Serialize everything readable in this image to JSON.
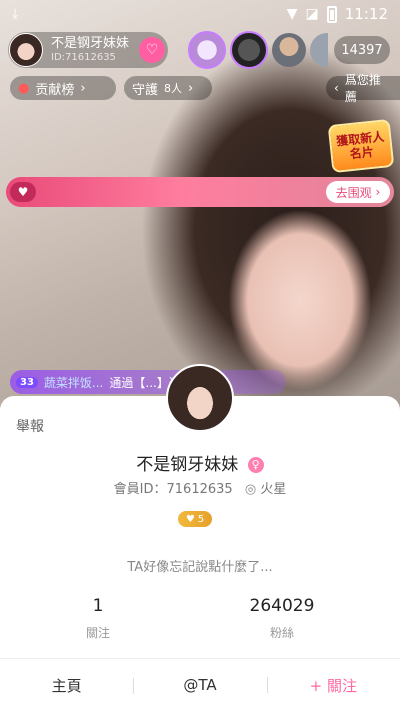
{
  "status_bar": {
    "time": "11:12",
    "download_icon": "download-icon",
    "wifi_icon": "wifi-icon",
    "signal_icon": "no-signal-icon"
  },
  "host": {
    "name": "不是钢牙妹妹",
    "id": "ID:71612635"
  },
  "viewers": {
    "count": "14397"
  },
  "chips": {
    "contribution": "贡献榜",
    "guard": "守護",
    "guard_count": "8人",
    "recommend": "爲您推薦"
  },
  "event_badge": {
    "text": "獲取新人名片"
  },
  "banner": {
    "button": "去围观"
  },
  "entry": {
    "level": "33",
    "user": "蔬菜拌饭...",
    "text": "通過【...】進入房間！"
  },
  "profile": {
    "report": "舉報",
    "name": "不是钢牙妹妹",
    "member_id": "會員ID：71612635",
    "location": "火星",
    "level": "5",
    "bio": "TA好像忘記說點什麼了...",
    "following_count": "1",
    "following_label": "關注",
    "fans_count": "264029",
    "fans_label": "粉絲"
  },
  "actions": {
    "home": "主頁",
    "mention": "@TA",
    "follow": "+ 關注"
  },
  "colors": {
    "accent": "#ff6aa2",
    "banner": "#e94a79"
  }
}
